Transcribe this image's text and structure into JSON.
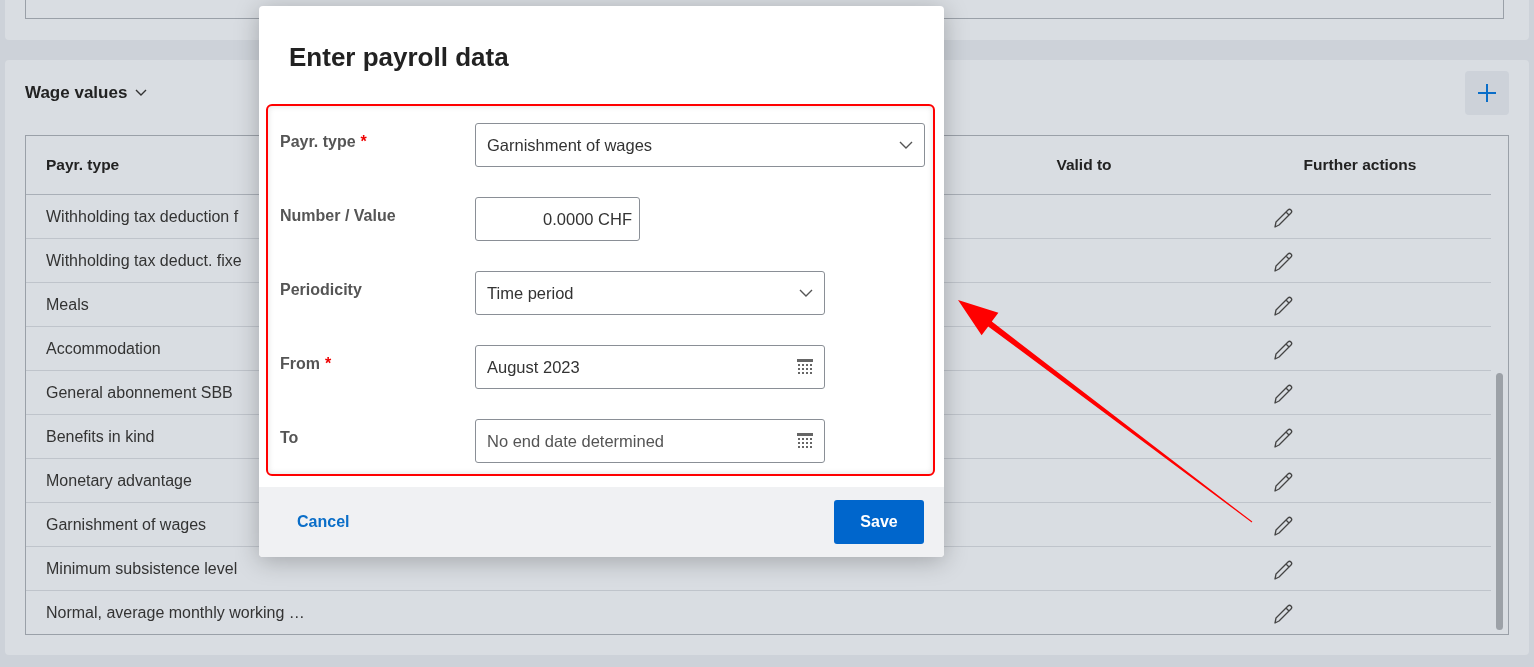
{
  "section": {
    "title": "Wage values"
  },
  "table": {
    "columns": [
      "Payr. type",
      "Valid to",
      "Further actions"
    ],
    "rows": [
      {
        "payr_type": "Withholding tax deduction f"
      },
      {
        "payr_type": "Withholding tax deduct. fixe"
      },
      {
        "payr_type": "Meals"
      },
      {
        "payr_type": "Accommodation"
      },
      {
        "payr_type": "General abonnement SBB"
      },
      {
        "payr_type": "Benefits in kind"
      },
      {
        "payr_type": "Monetary advantage"
      },
      {
        "payr_type": "Garnishment of wages"
      },
      {
        "payr_type": "Minimum subsistence level"
      },
      {
        "payr_type": "Normal, average monthly working …"
      }
    ]
  },
  "dialog": {
    "title": "Enter payroll data",
    "fields": [
      {
        "label": "Payr. type",
        "required_mark": "*",
        "kind": "select",
        "value": "Garnishment of wages"
      },
      {
        "label": "Number / Value",
        "kind": "number",
        "value": "0.0000 CHF"
      },
      {
        "label": "Periodicity",
        "kind": "select",
        "value": "Time period"
      },
      {
        "label": "From",
        "required_mark": "*",
        "kind": "date",
        "value": "August 2023"
      },
      {
        "label": "To",
        "kind": "date",
        "placeholder": "No end date determined"
      }
    ],
    "cancel": "Cancel",
    "save": "Save"
  }
}
